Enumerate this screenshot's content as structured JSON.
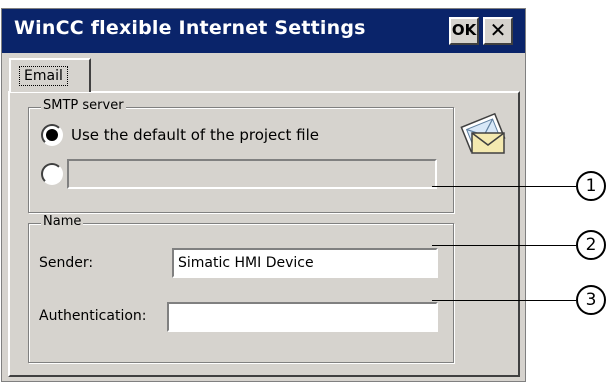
{
  "window": {
    "title": "WinCC flexible Internet Settings",
    "ok_label": "OK",
    "close_label": "✕"
  },
  "tabs": [
    {
      "label": "Email"
    }
  ],
  "smtp": {
    "legend": "SMTP server",
    "option_default_label": "Use the default of the project file",
    "option_default_selected": true,
    "server_value": ""
  },
  "name": {
    "legend": "Name",
    "sender_label": "Sender:",
    "sender_value": "Simatic HMI Device",
    "auth_label": "Authentication:",
    "auth_value": ""
  },
  "callouts": [
    "1",
    "2",
    "3"
  ],
  "icons": {
    "email": "mail-envelope-icon"
  }
}
